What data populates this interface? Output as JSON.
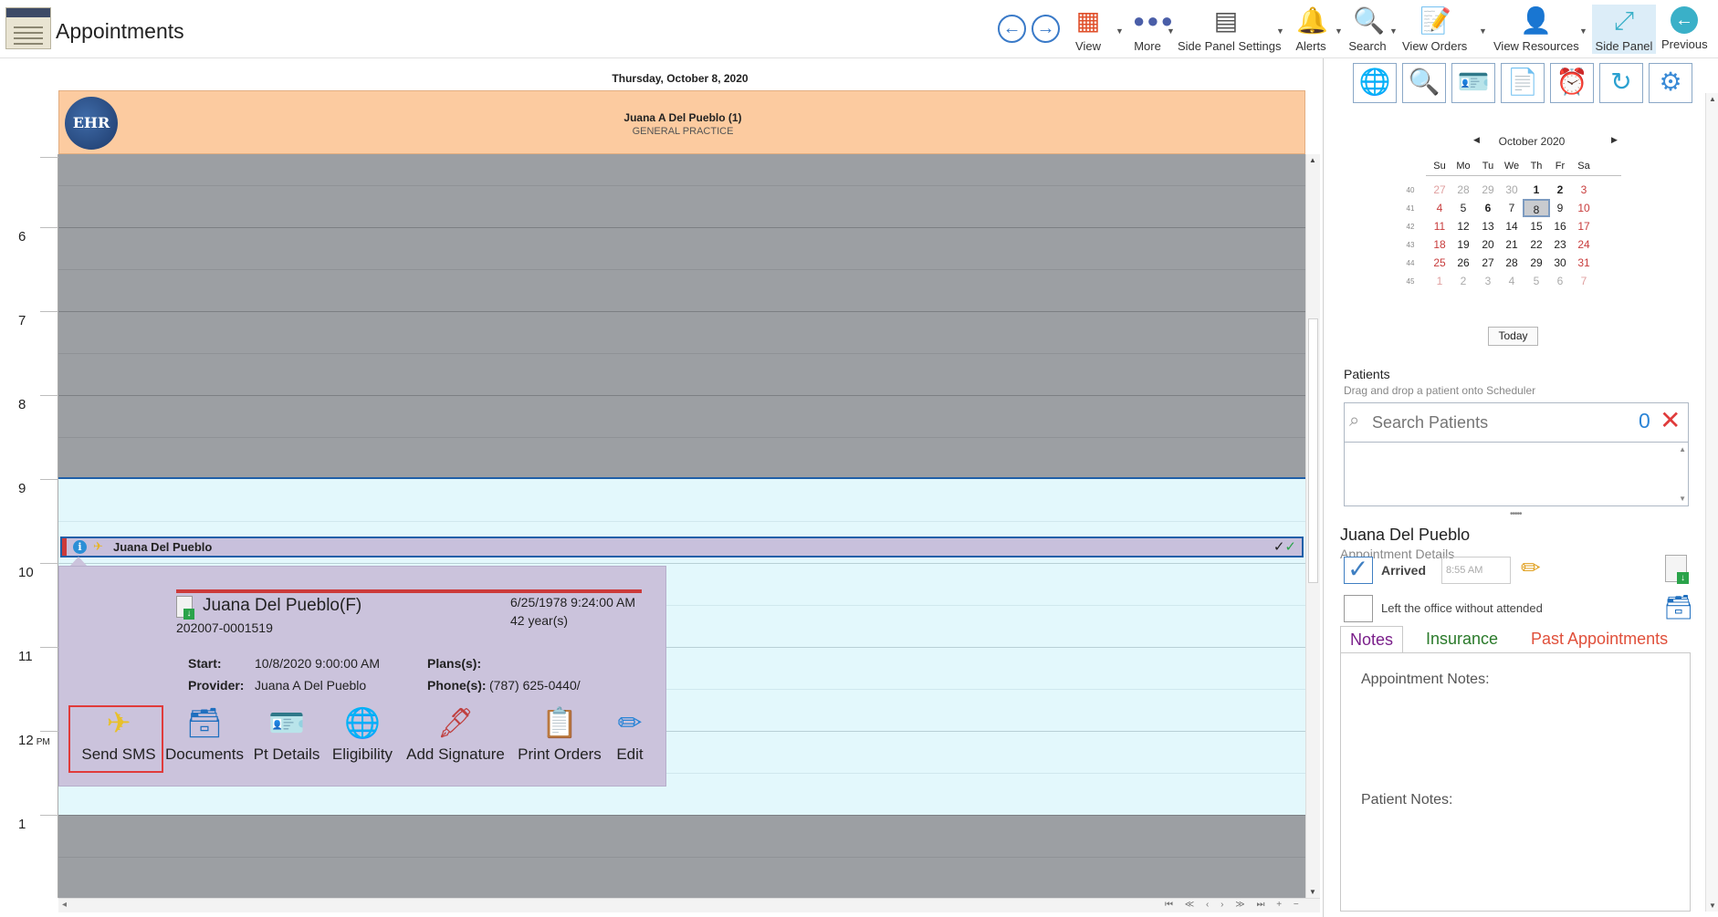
{
  "header": {
    "title": "Appointments",
    "toolbar": {
      "view": "View",
      "more": "More",
      "side_panel_settings": "Side Panel Settings",
      "alerts": "Alerts",
      "search": "Search",
      "view_orders": "View Orders",
      "view_resources": "View Resources",
      "side_panel": "Side Panel",
      "previous": "Previous"
    }
  },
  "calendar": {
    "date_label": "Thursday, October 8, 2020",
    "resource_name": "Juana A Del Pueblo (1)",
    "resource_specialty": "GENERAL PRACTICE",
    "logo_text": "EHR",
    "hours": [
      "6",
      "7",
      "8",
      "9",
      "10",
      "11",
      "12",
      "1"
    ],
    "pm_suffix": "PM"
  },
  "appointment": {
    "patient": "Juana Del Pueblo",
    "info_glyph": "i",
    "checks": "✓✓"
  },
  "popup": {
    "patient_name": "Juana Del Pueblo(F)",
    "patient_id": "202007-0001519",
    "dob": "6/25/1978 9:24:00 AM",
    "age": "42 year(s)",
    "start_label": "Start:",
    "start_value": "10/8/2020 9:00:00 AM",
    "provider_label": "Provider:",
    "provider_value": "Juana A Del Pueblo",
    "plans_label": "Plans(s):",
    "plans_value": "",
    "phones_label": "Phone(s):",
    "phones_value": "(787) 625-0440/",
    "actions": {
      "send_sms": "Send SMS",
      "documents": "Documents",
      "pt_details": "Pt Details",
      "eligibility": "Eligibility",
      "add_signature": "Add Signature",
      "print_orders": "Print Orders",
      "edit": "Edit"
    }
  },
  "side_panel": {
    "mini_calendar": {
      "month_label": "October 2020",
      "dow": [
        "Su",
        "Mo",
        "Tu",
        "We",
        "Th",
        "Fr",
        "Sa"
      ],
      "weeks": [
        {
          "wk": "40",
          "days": [
            "27",
            "28",
            "29",
            "30",
            "1",
            "2",
            "3"
          ]
        },
        {
          "wk": "41",
          "days": [
            "4",
            "5",
            "6",
            "7",
            "8",
            "9",
            "10"
          ]
        },
        {
          "wk": "42",
          "days": [
            "11",
            "12",
            "13",
            "14",
            "15",
            "16",
            "17"
          ]
        },
        {
          "wk": "43",
          "days": [
            "18",
            "19",
            "20",
            "21",
            "22",
            "23",
            "24"
          ]
        },
        {
          "wk": "44",
          "days": [
            "25",
            "26",
            "27",
            "28",
            "29",
            "30",
            "31"
          ]
        },
        {
          "wk": "45",
          "days": [
            "1",
            "2",
            "3",
            "4",
            "5",
            "6",
            "7"
          ]
        }
      ],
      "today_button": "Today"
    },
    "patients_title": "Patients",
    "patients_subtitle": "Drag and drop a patient onto Scheduler",
    "search_placeholder": "Search Patients",
    "result_count": "0",
    "selected_patient": "Juana Del Pueblo",
    "appointment_details": "Appointment Details",
    "arrived_label": "Arrived",
    "arrived_time": "8:55 AM",
    "left_label": "Left the office without attended",
    "tabs": {
      "notes": "Notes",
      "insurance": "Insurance",
      "past": "Past Appointments"
    },
    "appointment_notes_label": "Appointment Notes:",
    "patient_notes_label": "Patient Notes:"
  }
}
